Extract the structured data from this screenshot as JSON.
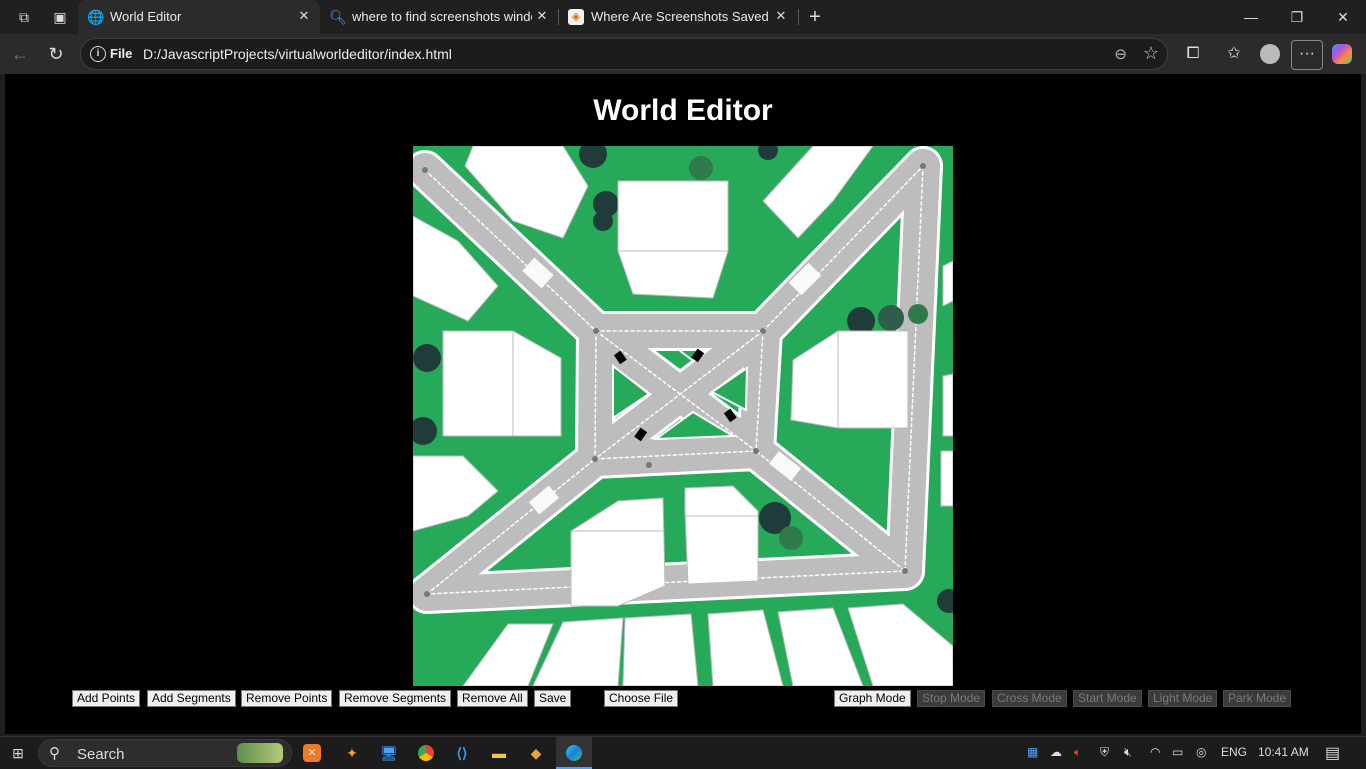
{
  "tabs": [
    {
      "title": "World Editor",
      "favicon": "globe-icon"
    },
    {
      "title": "where to find screenshots window",
      "favicon": "search-icon"
    },
    {
      "title": "Where Are Screenshots Saved on",
      "favicon": "site-icon"
    }
  ],
  "address": {
    "scheme_label": "File",
    "url": "D:/JavascriptProjects/virtualworldeditor/index.html"
  },
  "page": {
    "title": "World Editor",
    "buttons": [
      "Add Points",
      "Add Segments",
      "Remove Points",
      "Remove Segments",
      "Remove All",
      "Save"
    ],
    "file_input": "Choose File",
    "modes": [
      {
        "label": "Graph Mode",
        "enabled": true
      },
      {
        "label": "Stop Mode",
        "enabled": false
      },
      {
        "label": "Cross Mode",
        "enabled": false
      },
      {
        "label": "Start Mode",
        "enabled": false
      },
      {
        "label": "Light Mode",
        "enabled": false
      },
      {
        "label": "Park Mode",
        "enabled": false
      }
    ]
  },
  "taskbar": {
    "search_placeholder": "Search",
    "language": "ENG",
    "time": "10:41 AM"
  },
  "colors": {
    "grass": "#27a95a",
    "road": "#bdbdbd",
    "road_edge": "#ffffff",
    "building": "#ffffff",
    "tree": "#1f3b3a",
    "page_bg": "#000000"
  }
}
